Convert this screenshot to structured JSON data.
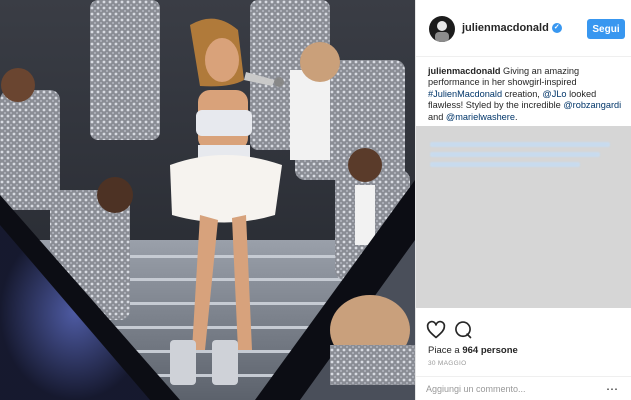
{
  "post": {
    "username": "julienmacdonald",
    "follow_label": "Segui",
    "caption_user": "julienmacdonald",
    "caption_parts": {
      "t1": " Giving an amazing performance in her showgirl-inspired ",
      "h1": "#JulienMacdonald",
      "t2": " creation, ",
      "m1": "@JLo",
      "t3": " looked flawless! Styled by the incredible ",
      "m2": "@robzangardi",
      "t4": " and ",
      "m3": "@marielwashere",
      "t5": "."
    },
    "likes_prefix": "Piace a ",
    "likes_count": "964 persone",
    "date": "30 MAGGIO",
    "comment_placeholder": "Aggiungi un commento...",
    "more_glyph": "⋯"
  },
  "icons": {
    "verified": "verified-badge-icon",
    "like": "heart-icon",
    "comment": "speech-bubble-icon",
    "more": "more-options-icon"
  },
  "colors": {
    "accent": "#3897f0",
    "link": "#003569",
    "text": "#262626",
    "muted": "#999999"
  }
}
